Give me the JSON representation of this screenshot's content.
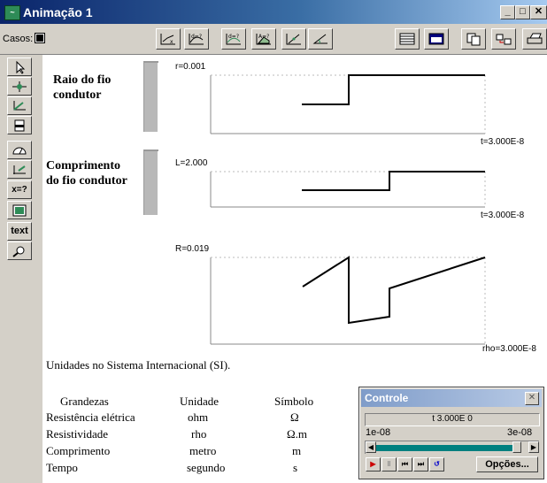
{
  "window": {
    "title": "Animação 1",
    "icon": "app-icon",
    "minimize": "_",
    "maximize": "□",
    "close": "✕"
  },
  "toolbar": {
    "casos_label": "Casos:"
  },
  "left_tools": {
    "text_label": "text",
    "xeq_label": "x=?"
  },
  "graphs": [
    {
      "label_line1": "Raio do fio",
      "label_line2": "condutor",
      "value": "r=0.001",
      "axis": "t=3.000E-8"
    },
    {
      "label_line1": "Comprimento",
      "label_line2": "do fio condutor",
      "value": "L=2.000",
      "axis": "t=3.000E-8"
    },
    {
      "value": "R=0.019",
      "axis": "rho=3.000E-8"
    }
  ],
  "units_note": "Unidades no Sistema Internacional (SI).",
  "table": {
    "headers": [
      "Grandezas",
      "Unidade",
      "Símbolo"
    ],
    "rows": [
      [
        "Resistência elétrica",
        "ohm",
        "Ω"
      ],
      [
        "Resistividade",
        "rho",
        "Ω.m"
      ],
      [
        "Comprimento",
        "metro",
        "m"
      ],
      [
        "Tempo",
        "segundo",
        "s"
      ]
    ]
  },
  "controle": {
    "title": "Controle",
    "close": "✕",
    "display": "t     3.000E 0",
    "range_min": "1e-08",
    "range_max": "3e-08",
    "slider_position": 0.95,
    "options_label": "Opções...",
    "accent": "#007f7f"
  }
}
